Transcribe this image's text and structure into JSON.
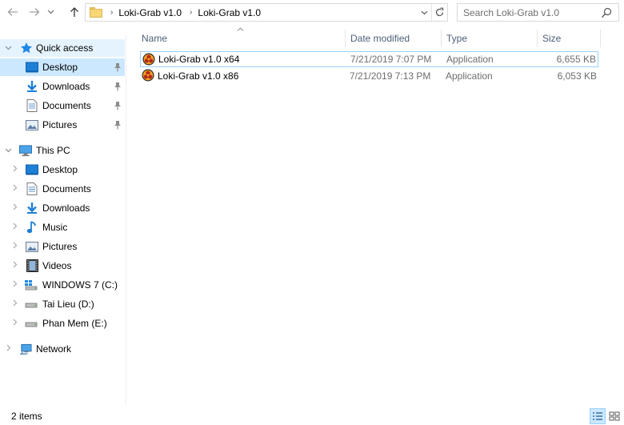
{
  "navigation": {
    "back_icon": "arrow-left-icon",
    "forward_icon": "arrow-right-icon",
    "recent_icon": "chevron-down-icon",
    "up_icon": "arrow-up-icon"
  },
  "address_bar": {
    "breadcrumbs": [
      "Loki-Grab v1.0",
      "Loki-Grab v1.0"
    ],
    "separator": "›",
    "dropdown_glyph": "⌄",
    "refresh_glyph": "↻"
  },
  "search": {
    "placeholder": "Search Loki-Grab v1.0"
  },
  "sidebar": {
    "quick_access": {
      "label": "Quick access",
      "items": [
        {
          "label": "Desktop",
          "icon": "desktop-icon",
          "pinned": true,
          "selected": true
        },
        {
          "label": "Downloads",
          "icon": "downloads-icon",
          "pinned": true
        },
        {
          "label": "Documents",
          "icon": "documents-icon",
          "pinned": true
        },
        {
          "label": "Pictures",
          "icon": "pictures-icon",
          "pinned": true
        }
      ]
    },
    "this_pc": {
      "label": "This PC",
      "items": [
        {
          "label": "Desktop",
          "icon": "desktop-icon"
        },
        {
          "label": "Documents",
          "icon": "documents-icon"
        },
        {
          "label": "Downloads",
          "icon": "downloads-icon"
        },
        {
          "label": "Music",
          "icon": "music-icon"
        },
        {
          "label": "Pictures",
          "icon": "pictures-icon"
        },
        {
          "label": "Videos",
          "icon": "videos-icon"
        },
        {
          "label": "WINDOWS 7 (C:)",
          "icon": "windows-drive-icon"
        },
        {
          "label": "Tai Lieu  (D:)",
          "icon": "drive-icon"
        },
        {
          "label": "Phan Mem (E:)",
          "icon": "drive-icon"
        }
      ]
    },
    "network": {
      "label": "Network",
      "icon": "network-icon"
    }
  },
  "file_list": {
    "sort_glyph": "^",
    "columns": [
      "Name",
      "Date modified",
      "Type",
      "Size"
    ],
    "rows": [
      {
        "name": "Loki-Grab v1.0 x64",
        "date": "7/21/2019 7:07 PM",
        "type": "Application",
        "size": "6,655 KB",
        "icon": "biohazard-app-icon"
      },
      {
        "name": "Loki-Grab v1.0 x86",
        "date": "7/21/2019 7:13 PM",
        "type": "Application",
        "size": "6,053 KB",
        "icon": "biohazard-app-icon"
      }
    ]
  },
  "status": {
    "items_count": "2 items"
  },
  "colors": {
    "selection": "#cce8ff",
    "hover": "#e5f3ff",
    "header_text": "#4c607a",
    "muted_text": "#6d6d6d",
    "accent_blue": "#0078d7"
  }
}
